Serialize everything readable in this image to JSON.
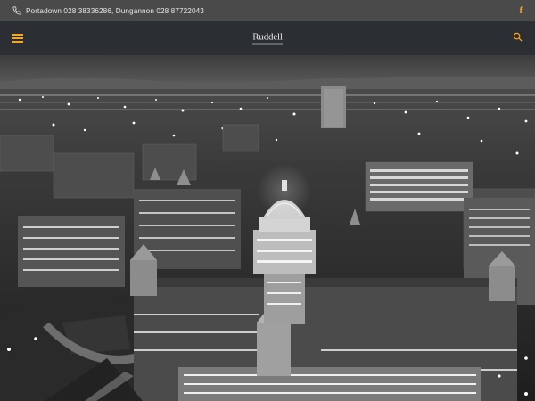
{
  "topbar": {
    "contact_text": "Portadown 028 38336286, Dungannon 028 87722043",
    "phone_icon": "phone-icon",
    "facebook_icon": "facebook-icon",
    "facebook_glyph": "f"
  },
  "navbar": {
    "logo_text": "Ruddell",
    "menu_icon": "hamburger-menu-icon",
    "search_icon": "search-icon"
  },
  "colors": {
    "accent": "#f5a623",
    "topbar_bg": "#4a4a4a",
    "navbar_bg": "#2b2e33"
  },
  "hero": {
    "image": "grayscale aerial night cityscape with domed city hall"
  }
}
